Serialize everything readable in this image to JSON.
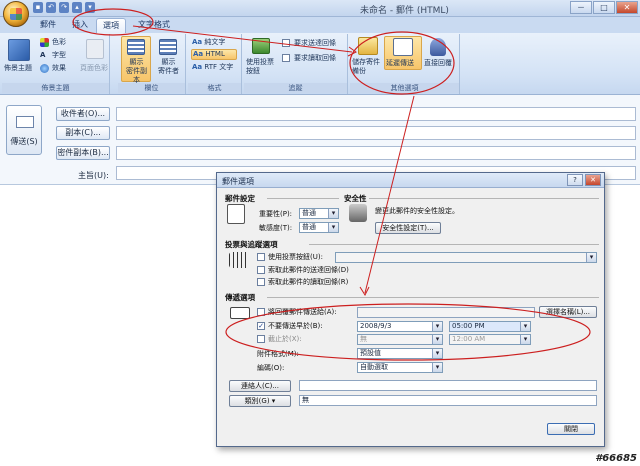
{
  "window": {
    "title": "未命名 - 郵件 (HTML)"
  },
  "quick_access": [
    "save-icon",
    "undo-icon",
    "redo-icon",
    "up-icon",
    "down-icon"
  ],
  "window_controls": [
    "－",
    "□",
    "✕"
  ],
  "tabs": [
    {
      "label": "郵件"
    },
    {
      "label": "插入"
    },
    {
      "label": "選項"
    },
    {
      "label": "文字格式"
    }
  ],
  "ribbon": {
    "theme_group": {
      "label": "佈景主題",
      "big_button": "佈景主題",
      "colors": "色彩",
      "fonts": "字型",
      "effects": "效果",
      "page_color": "頁面色彩"
    },
    "fields_group": {
      "label": "欄位",
      "show_bcc": "顯示\n密件副本",
      "show_from": "顯示\n寄件者"
    },
    "format_group": {
      "label": "格式",
      "plain_text": "純文字",
      "html": "HTML",
      "rtf": "RTF 文字"
    },
    "tracking_group": {
      "label": "追蹤",
      "use_voting": "使用投票\n按鈕",
      "request_delivery": "要求送達回條",
      "request_read": "要求讀取回條"
    },
    "other_group": {
      "label": "其他選項",
      "save_sent": "儲存寄件\n備份",
      "delay_delivery": "延遲傳送",
      "direct_replies": "直接回覆"
    }
  },
  "message": {
    "send_label": "傳送(S)",
    "to_button": "收件者(O)...",
    "cc_button": "副本(C)...",
    "bcc_button": "密件副本(B)...",
    "subject_label": "主旨(U):"
  },
  "dialog": {
    "title": "郵件選項",
    "help": "?",
    "close": "✕",
    "msg_settings": {
      "heading": "郵件設定",
      "importance_label": "重要性(P):",
      "importance_value": "普通",
      "sensitivity_label": "敏感度(T):",
      "sensitivity_value": "普通"
    },
    "security": {
      "heading": "安全性",
      "desc": "變更此郵件的安全性設定。",
      "button": "安全性設定(T)..."
    },
    "voting": {
      "heading": "投票與追蹤選項",
      "use_voting": "使用投票按鈕(U):",
      "request_delivery": "索取此郵件的送達回條(D)",
      "request_read": "索取此郵件的讀取回條(R)"
    },
    "delivery": {
      "heading": "傳遞選項",
      "reply_to": "將回覆郵件傳送給(A):",
      "select_names": "選擇名稱(L)...",
      "do_not_deliver": "不要傳送早於(B):",
      "do_not_deliver_checked": true,
      "date": "2008/9/3",
      "time": "05:00 PM",
      "expires": "截止於(X):",
      "expires_date": "無",
      "expires_time": "12:00 AM",
      "attachment_format_label": "附件格式(M):",
      "attachment_format_value": "預設值",
      "encoding_label": "編碼(O):",
      "encoding_value": "自動選取"
    },
    "contacts_button": "連絡人(C)...",
    "categories_button": "類別(G)",
    "categories_value": "無",
    "close_button": "關閉"
  },
  "annotation_color": "#cc1f1f",
  "watermark": "#66685"
}
